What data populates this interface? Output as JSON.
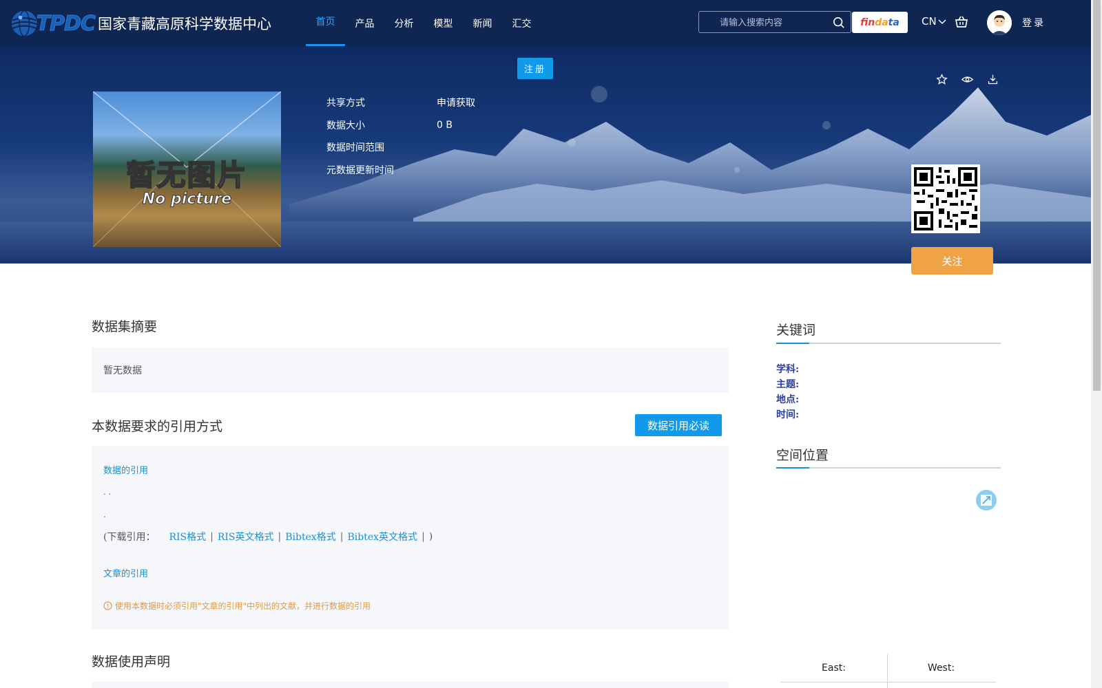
{
  "header": {
    "logo_text": "TPDC",
    "logo_cn": "国家青藏高原科学数据中心",
    "nav": [
      {
        "label": "首页",
        "active": true
      },
      {
        "label": "产品",
        "active": false
      },
      {
        "label": "分析",
        "active": false
      },
      {
        "label": "模型",
        "active": false
      },
      {
        "label": "新闻",
        "active": false
      },
      {
        "label": "汇交",
        "active": false
      }
    ],
    "search_placeholder": "请输入搜索内容",
    "findata_label_a": "fin",
    "findata_label_b": "da",
    "findata_label_c": "ta",
    "lang": "CN",
    "login": "登录"
  },
  "hero": {
    "register": "注册",
    "thumb_title": "暂无图片",
    "thumb_sub": "No picture",
    "meta": [
      {
        "label": "共享方式",
        "value": "申请获取"
      },
      {
        "label": "数据大小",
        "value": "0 B"
      },
      {
        "label": "数据时间范围",
        "value": ""
      },
      {
        "label": "元数据更新时间",
        "value": ""
      }
    ],
    "follow": "关注"
  },
  "main": {
    "abstract_title": "数据集摘要",
    "abstract_text": "暂无数据",
    "citation_title": "本数据要求的引用方式",
    "cite_must_read": "数据引用必读",
    "data_citation_label": "数据的引用",
    "cite_line1": ". .",
    "cite_line2": ".",
    "download_prefix": "(下载引用：",
    "download_links": [
      "RIS格式",
      "RIS英文格式",
      "Bibtex格式",
      "Bibtex英文格式"
    ],
    "download_suffix": ")",
    "paper_citation_label": "文章的引用",
    "warning": "使用本数据时必须引用\"文章的引用\"中列出的文献，并进行数据的引用",
    "usage_title": "数据使用声明"
  },
  "sidebar": {
    "keywords_title": "关键词",
    "keywords": [
      "学科:",
      "主题:",
      "地点:",
      "时间:"
    ],
    "spatial_title": "空间位置",
    "east": "East:",
    "west": "West:"
  },
  "colors": {
    "nav_bg": "#0f2552",
    "accent": "#119ae9",
    "follow": "#f0a344",
    "keyword": "#2a3fa8"
  }
}
